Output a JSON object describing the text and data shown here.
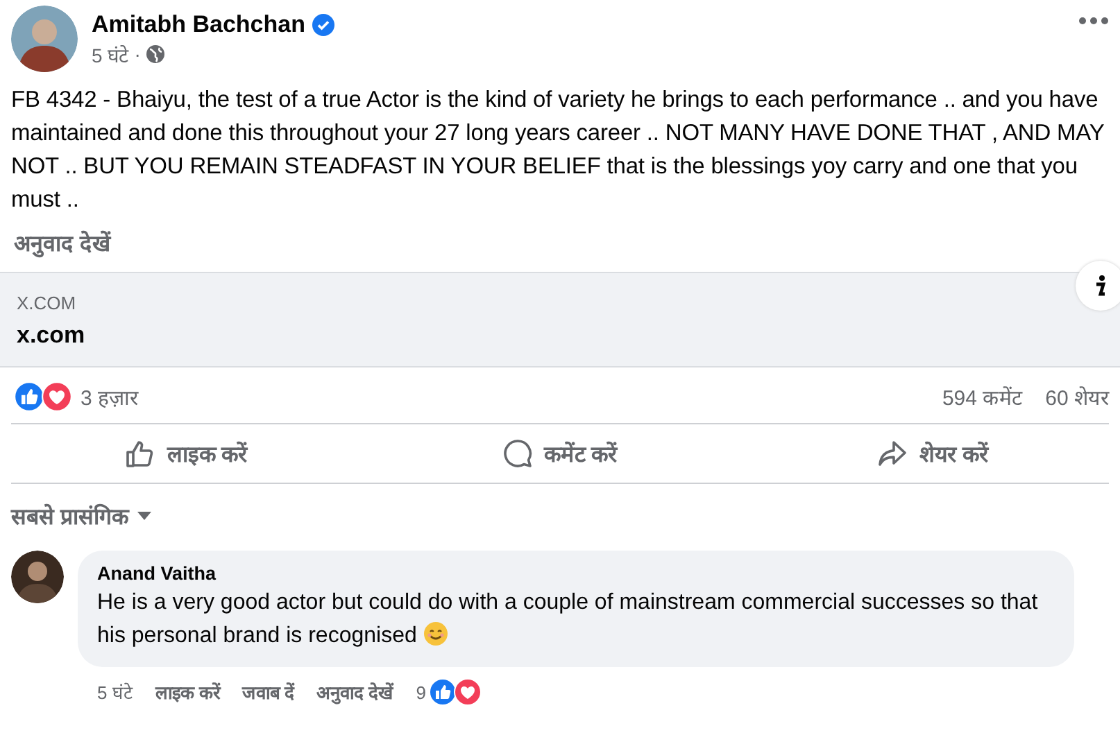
{
  "post": {
    "author": "Amitabh Bachchan",
    "verified": true,
    "time": "5 घंटे",
    "separator": "·",
    "text": "FB 4342 - Bhaiyu, the test of a true Actor is the kind of variety he brings to each performance .. and you have maintained and done this throughout your 27 long years career .. NOT MANY HAVE DONE THAT , AND MAY NOT  .. BUT YOU REMAIN STEADFAST IN YOUR BELIEF that is the blessings yoy carry and one that you must ..",
    "translate": "अनुवाद देखें",
    "link": {
      "domain": "X.COM",
      "title": "x.com"
    },
    "reactions_count": "3 हज़ार",
    "comments_count": "594 कमेंट",
    "shares_count": "60 शेयर",
    "actions": [
      {
        "kind": "like",
        "label": "लाइक करें"
      },
      {
        "kind": "comment",
        "label": "कमेंट करें"
      },
      {
        "kind": "share",
        "label": "शेयर करें"
      }
    ]
  },
  "comment_sort": "सबसे प्रासंगिक",
  "comments": [
    {
      "author": "Anand Vaitha",
      "text": "He is a very good actor but could do with a couple of mainstream commercial successes so that his personal brand is recognised",
      "emoji": true,
      "time": "5 घंटे",
      "actions": [
        "लाइक करें",
        "जवाब दें",
        "अनुवाद देखें"
      ],
      "reactions_count": "9"
    }
  ]
}
